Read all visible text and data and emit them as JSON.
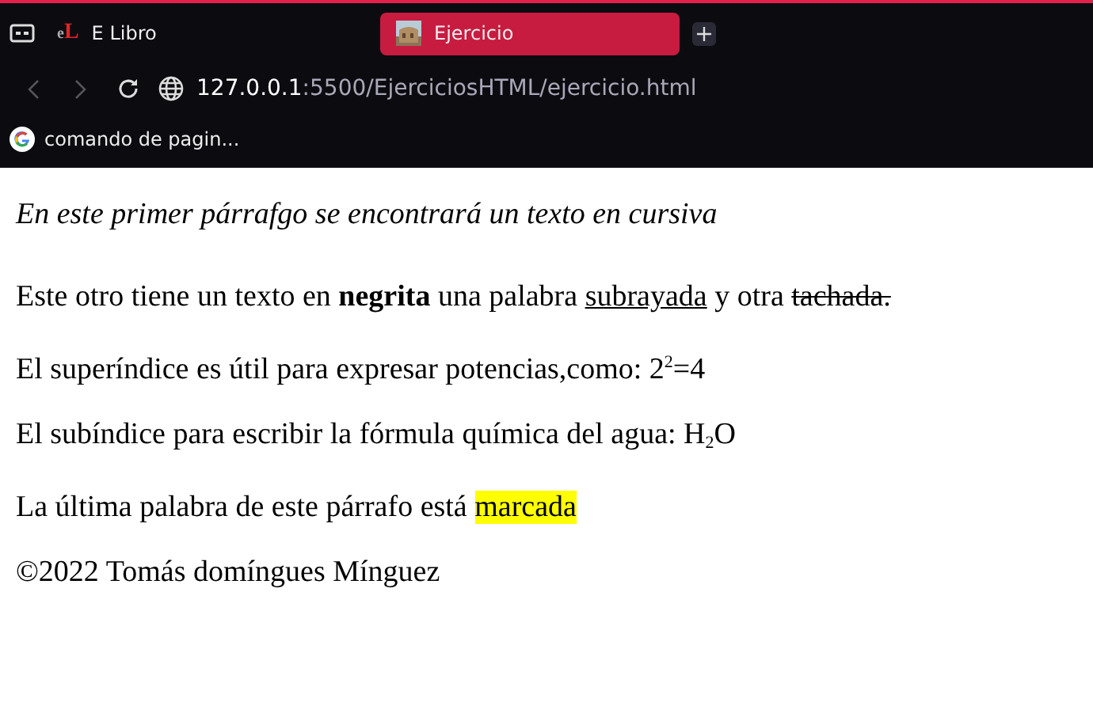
{
  "tabs": [
    {
      "label": "E Libro",
      "logo": "eL",
      "selected": false
    },
    {
      "label": "Ejercicio",
      "selected": true
    }
  ],
  "address": {
    "host": "127.0.0.1",
    "path": ":5500/EjerciciosHTML/ejercicio.html"
  },
  "bookmarks": [
    {
      "label": "comando de pagin..."
    }
  ],
  "paragraphs": [
    {
      "segments": [
        {
          "kind": "italic",
          "text": "En este primer párrafgo se encontrará un texto en cursiva"
        }
      ]
    },
    {
      "segments": [
        {
          "kind": "plain",
          "text": "Este otro tiene un texto en "
        },
        {
          "kind": "bold",
          "text": "negrita"
        },
        {
          "kind": "plain",
          "text": " una palabra "
        },
        {
          "kind": "underline",
          "text": "subrayada"
        },
        {
          "kind": "plain",
          "text": " y otra "
        },
        {
          "kind": "strike",
          "text": "tachada."
        }
      ]
    },
    {
      "segments": [
        {
          "kind": "plain",
          "text": "El superíndice es útil para expresar potencias,como: 2"
        },
        {
          "kind": "sup",
          "text": "2"
        },
        {
          "kind": "plain",
          "text": "=4"
        }
      ]
    },
    {
      "segments": [
        {
          "kind": "plain",
          "text": "El subíndice para escribir la fórmula química del agua: H"
        },
        {
          "kind": "sub",
          "text": "2"
        },
        {
          "kind": "plain",
          "text": "O"
        }
      ]
    },
    {
      "segments": [
        {
          "kind": "plain",
          "text": "La última palabra de este párrafo está "
        },
        {
          "kind": "mark",
          "text": "marcada"
        }
      ]
    },
    {
      "segments": [
        {
          "kind": "plain",
          "text": "©2022 Tomás domíngues Mínguez"
        }
      ]
    }
  ]
}
